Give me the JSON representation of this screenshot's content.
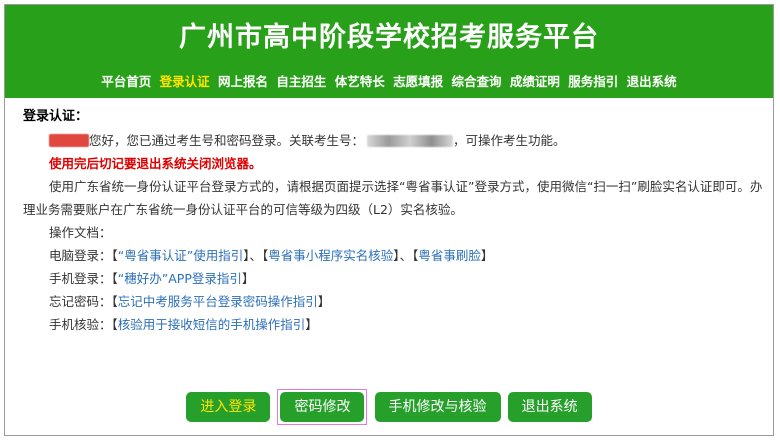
{
  "site": {
    "title": "广州市高中阶段学校招考服务平台"
  },
  "nav": {
    "items": [
      {
        "label": "平台首页",
        "active": false
      },
      {
        "label": "登录认证",
        "active": true
      },
      {
        "label": "网上报名",
        "active": false
      },
      {
        "label": "自主招生",
        "active": false
      },
      {
        "label": "体艺特长",
        "active": false
      },
      {
        "label": "志愿填报",
        "active": false
      },
      {
        "label": "综合查询",
        "active": false
      },
      {
        "label": "成绩证明",
        "active": false
      },
      {
        "label": "服务指引",
        "active": false
      },
      {
        "label": "退出系统",
        "active": false
      }
    ]
  },
  "content": {
    "section_title": "登录认证：",
    "greeting_text": "您好，您已通过考生号和密码登录。关联考生号：",
    "greeting_tail": "，可操作考生功能。",
    "warning": "使用完后切记要退出系统关闭浏览器。",
    "paragraph": "使用广东省统一身份认证平台登录方式的，请根据页面提示选择“粤省事认证”登录方式，使用微信“扫一扫”刷脸实名认证即可。办理业务需要账户在广东省统一身份认证平台的可信等级为四级（L2）实名核验。",
    "docs_label": "操作文档：",
    "doc_rows": {
      "pc": {
        "label": "电脑登录：",
        "links": [
          "“粤省事认证”使用指引",
          "粤省事小程序实名核验",
          "粤省事刷脸"
        ],
        "separator": "、"
      },
      "mobile": {
        "label": "手机登录：",
        "link": "“穗好办”APP登录指引"
      },
      "forgot": {
        "label": "忘记密码：",
        "link": "忘记中考服务平台登录密码操作指引"
      },
      "verify": {
        "label": "手机核验：",
        "link": "核验用于接收短信的手机操作指引"
      }
    },
    "bracket_open": "【",
    "bracket_close": "】"
  },
  "buttons": {
    "login": "进入登录",
    "change_password": "密码修改",
    "change_phone": "手机修改与核验",
    "logout": "退出系统"
  },
  "colors": {
    "header_green": "#29a019",
    "nav_active": "#ffe400",
    "warning_red": "#e00000",
    "link_blue": "#2b6fb8",
    "highlight_border": "#e27ad6"
  }
}
